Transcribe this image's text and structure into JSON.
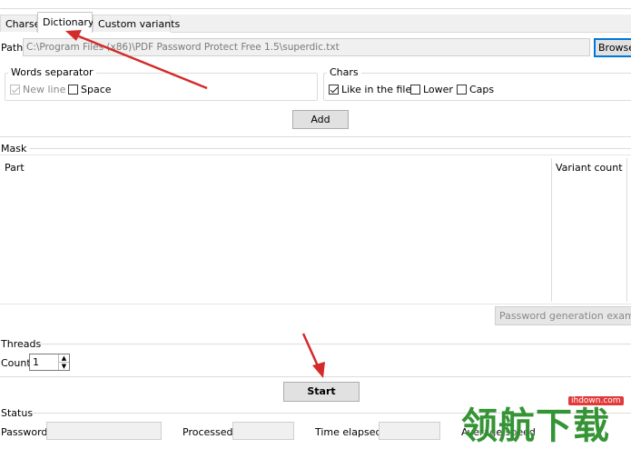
{
  "tabs": [
    {
      "label": "Charset",
      "active": false
    },
    {
      "label": "Dictionary",
      "active": true
    },
    {
      "label": "Custom variants",
      "active": false
    }
  ],
  "path": {
    "label": "Path",
    "value": "C:\\Program Files (x86)\\PDF Password Protect Free 1.5\\superdic.txt",
    "browse_label": "Browse"
  },
  "words_separator": {
    "title": "Words separator",
    "new_line": {
      "label": "New line",
      "checked": true,
      "enabled": false
    },
    "space": {
      "label": "Space",
      "checked": false
    }
  },
  "chars": {
    "title": "Chars",
    "like_in_file": {
      "label": "Like in the file",
      "checked": true
    },
    "lower": {
      "label": "Lower",
      "checked": false
    },
    "caps": {
      "label": "Caps",
      "checked": false
    }
  },
  "add_label": "Add",
  "mask": {
    "title": "Mask",
    "columns": [
      "Part",
      "Variant count"
    ],
    "example_button": "Password generation example"
  },
  "threads": {
    "title": "Threads",
    "count_label": "Count",
    "count_value": "1"
  },
  "start_label": "Start",
  "status": {
    "title": "Status",
    "password_label": "Password",
    "processed_label": "Processed",
    "time_elapsed_label": "Time elapsed",
    "average_speed_label": "Average speed"
  },
  "watermark": {
    "text": "领航下载",
    "site": "ihdown.com"
  },
  "colors": {
    "annotation_arrow": "#d42a2a",
    "focus_border": "#0078d7"
  }
}
